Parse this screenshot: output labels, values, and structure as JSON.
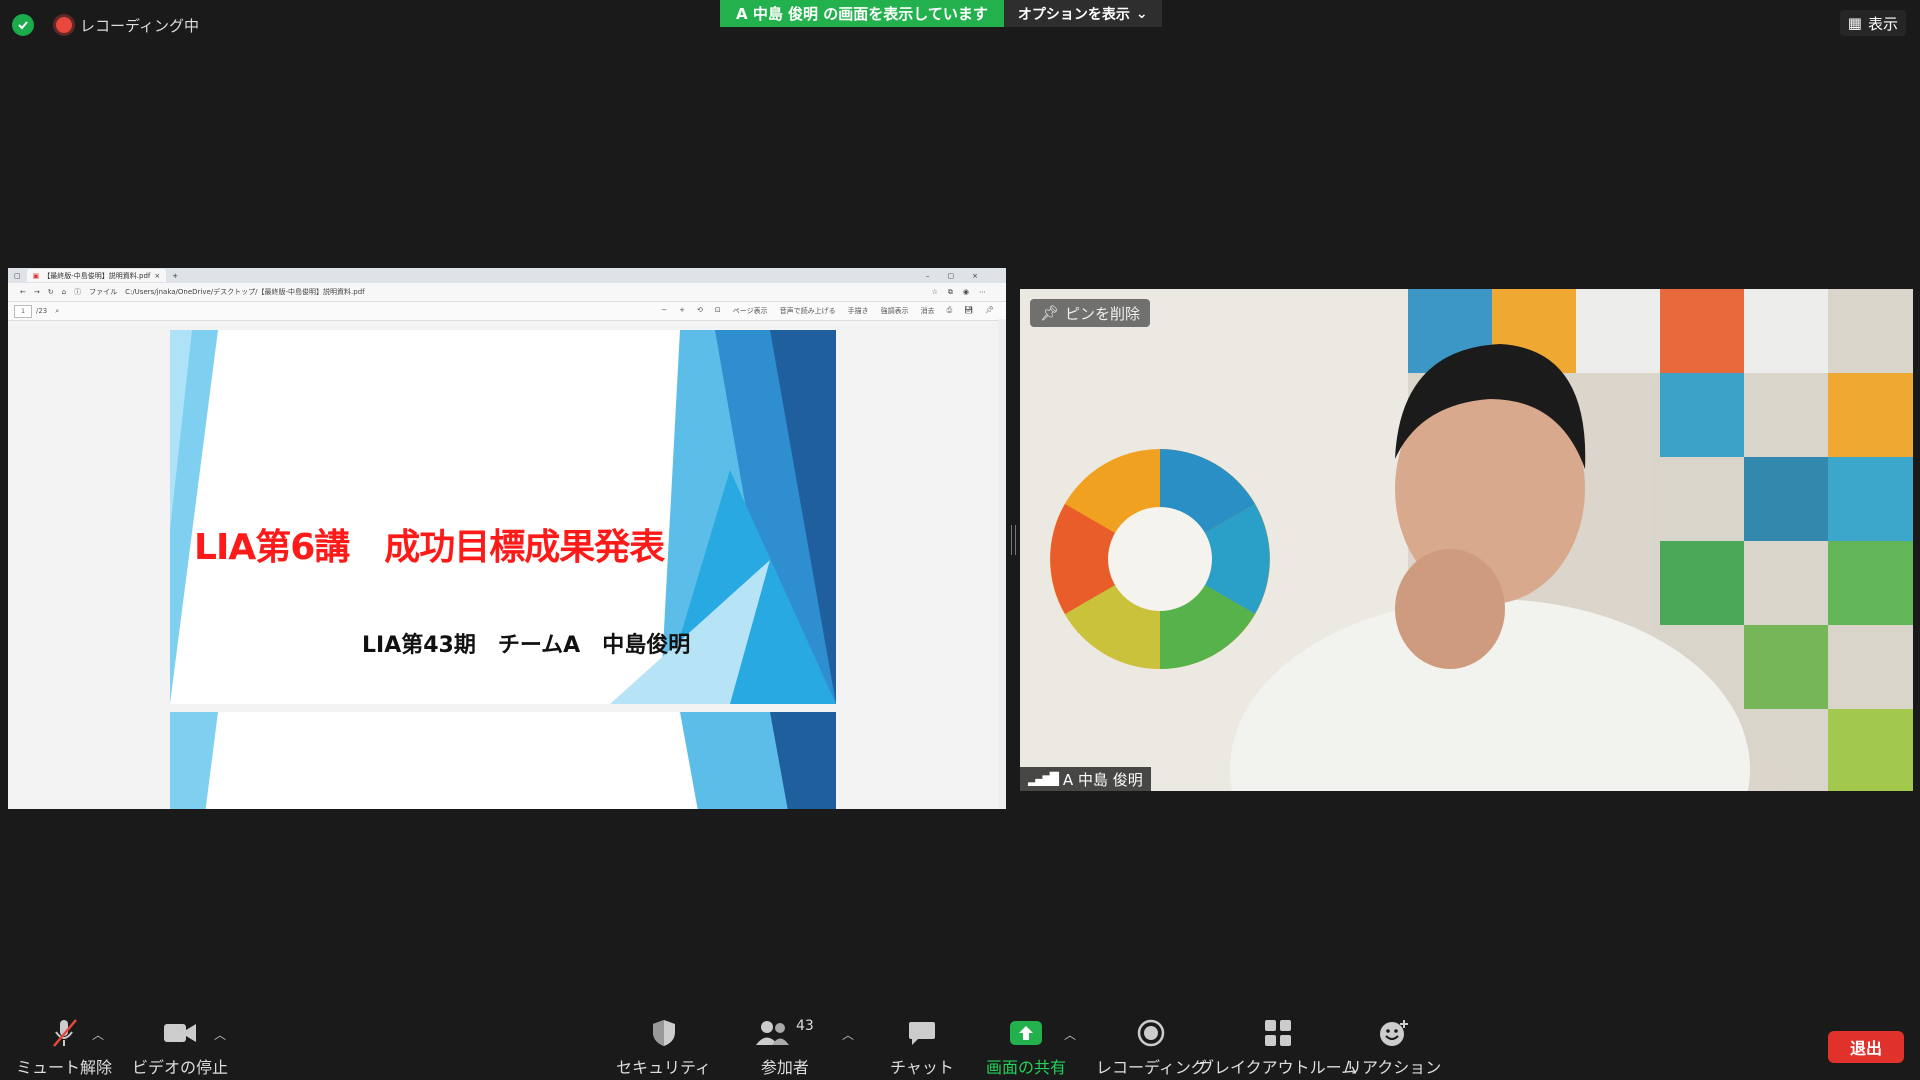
{
  "top": {
    "recording": "レコーディング中",
    "banner": "A 中島 俊明 の画面を表示しています",
    "options": "オプションを表示",
    "view": "表示"
  },
  "browser": {
    "tab_title": "【最終版-中島俊明】説明資料.pdf",
    "address_label": "ファイル",
    "address": "C:/Users/jnaka/OneDrive/デスクトップ/【最終版-中島俊明】説明資料.pdf",
    "page_current": "1",
    "page_total": "/23",
    "tools": [
      "ページ表示",
      "音声で読み上げる",
      "手描き",
      "強調表示",
      "消去"
    ]
  },
  "slide": {
    "title": "LIA第6講　成功目標成果発表",
    "subtitle": "LIA第43期　チームA　中島俊明"
  },
  "camera": {
    "pin_label": "ピンを削除",
    "participant_name": "A 中島 俊明"
  },
  "toolbar": {
    "unmute": "ミュート解除",
    "stop_video": "ビデオの停止",
    "security": "セキュリティ",
    "participants": "参加者",
    "participants_count": "43",
    "chat": "チャット",
    "share": "画面の共有",
    "record": "レコーディング",
    "breakout": "ブレイクアウトルーム",
    "reactions": "リアクション",
    "leave": "退出"
  },
  "colors": {
    "green": "#23b14d",
    "red": "#e0312b",
    "slide_title": "#ff1a1a"
  }
}
